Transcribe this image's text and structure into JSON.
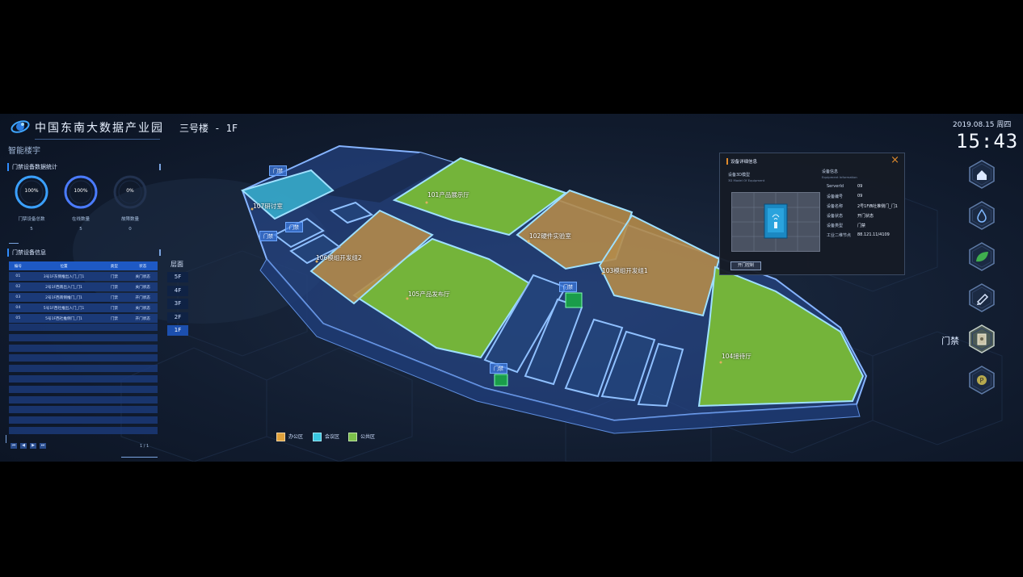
{
  "header": {
    "app_title": "中国东南大数据产业园",
    "building": "三号楼 - 1F",
    "module": "智能楼宇",
    "date": "2019.08.15 周四",
    "time": "15:43"
  },
  "stats_panel": {
    "title": "门禁设备数据统计",
    "rings": [
      {
        "percent_text": "100%",
        "label": "门禁设备总数",
        "value": "5",
        "fraction": 1.0,
        "color": "#3aa0ff"
      },
      {
        "percent_text": "100%",
        "label": "在线数量",
        "value": "5",
        "fraction": 1.0,
        "color": "#4a7bff"
      },
      {
        "percent_text": "0%",
        "label": "故障数量",
        "value": "0",
        "fraction": 0.0,
        "color": "#3a6bd8"
      }
    ]
  },
  "device_panel": {
    "title": "门禁设备信息",
    "columns": [
      "编号",
      "位置",
      "类型",
      "状态"
    ],
    "rows": [
      [
        "01",
        "3号1F东侧推出入门_门1",
        "门禁",
        "关门状态"
      ],
      [
        "02",
        "2号1F西南出入门_门1",
        "门禁",
        "关门状态"
      ],
      [
        "03",
        "2号1F西南侧推门_门1",
        "门禁",
        "开门状态"
      ],
      [
        "04",
        "5号1F西社推出入门_门1",
        "门禁",
        "关门状态"
      ],
      [
        "05",
        "5号1F西社推侧门_门1",
        "门禁",
        "开门状态"
      ]
    ],
    "page_info": "1 / 1",
    "pager": [
      "⏮",
      "◀",
      "▶",
      "⏭"
    ]
  },
  "floors": {
    "heading": "层面",
    "items": [
      "5F",
      "4F",
      "3F",
      "2F",
      "1F"
    ],
    "active": "1F"
  },
  "map": {
    "rooms": [
      {
        "name": "101产品展示厅"
      },
      {
        "name": "102硬件实验室"
      },
      {
        "name": "103模组开发组1"
      },
      {
        "name": "104接待厅"
      },
      {
        "name": "105产品发布厅"
      },
      {
        "name": "106模组开发组2"
      },
      {
        "name": "107研讨室"
      }
    ],
    "door_tag": "门禁"
  },
  "legend": {
    "items": [
      {
        "label": "办公区",
        "color": "#e0a23c"
      },
      {
        "label": "会议区",
        "color": "#39c6e0"
      },
      {
        "label": "公共区",
        "color": "#7cc04a"
      }
    ]
  },
  "detail_panel": {
    "title": "设备详细信息",
    "model_title": "设备3D模型",
    "model_sub": "3D Model Of Equipment",
    "info_title": "设备信息",
    "info_sub": "Equipment Information",
    "fields": [
      {
        "key": "ServerId",
        "value": "09"
      },
      {
        "key": "设备编号",
        "value": "09"
      },
      {
        "key": "设备名称",
        "value": "2号1F西社推侧门_门1"
      },
      {
        "key": "设备状态",
        "value": "开门状态"
      },
      {
        "key": "设备类型",
        "value": "门禁"
      },
      {
        "key": "工业二维节点",
        "value": "88.121.11/4109"
      }
    ],
    "open_button": "开门控制",
    "close_icon": "×"
  },
  "right_nav": {
    "items": [
      "home-icon",
      "water-drop-icon",
      "leaf-icon",
      "fire-alarm-icon",
      "access-control-icon",
      "parking-icon"
    ],
    "active_label": "门禁"
  }
}
